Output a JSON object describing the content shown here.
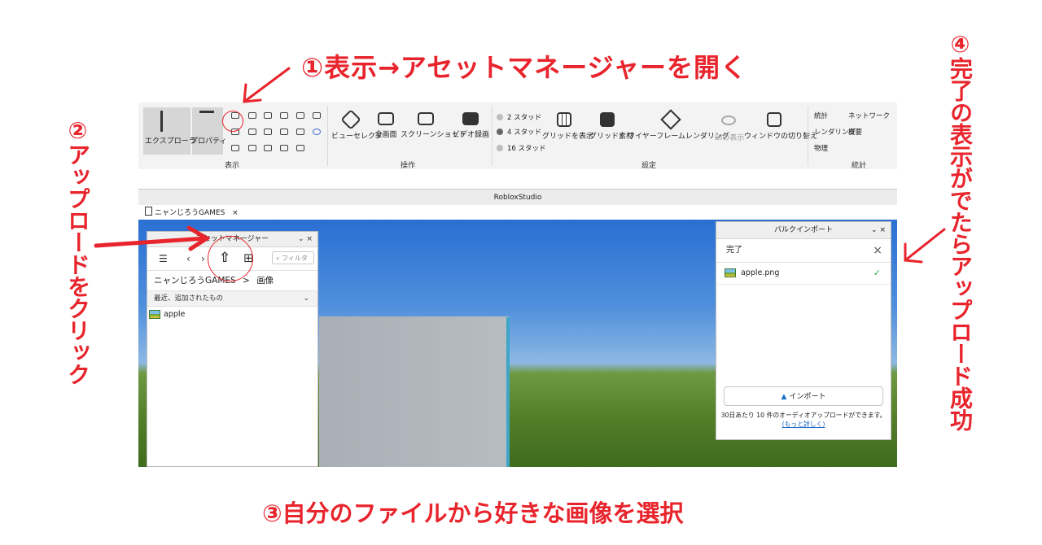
{
  "annotations": {
    "step1": "①表示→アセットマネージャーを開く",
    "step2": "②アップロードをクリック",
    "step3": "③自分のファイルから好きな画像を選択",
    "step4": "④完了の表示がでたらアップロード成功"
  },
  "ribbon": {
    "explorer_label": "エクスプローラ",
    "properties_label": "プロパティ",
    "view_group": "表示",
    "view_selector": "ビューセレクタ",
    "fullscreen": "全画面",
    "screenshot": "スクリーンショット",
    "video_record": "ビデオ録画",
    "actions_group": "操作",
    "stud2": "2 スタッド",
    "stud4": "4 スタッド",
    "stud16": "16 スタッド",
    "show_grid": "グリッドを表示",
    "grid_material": "グリッド素材",
    "wireframe": "ワイヤーフレームレンダリング",
    "ui_display": "UIの表示",
    "window_toggle": "ウィンドウの切り替え",
    "settings_group": "設定",
    "stats": "統計",
    "network": "ネットワーク",
    "rendering": "レンダリング",
    "summary": "概要",
    "physics": "物理",
    "stats_group": "統計"
  },
  "studio": {
    "title": "RobloxStudio",
    "tab_label": "ニャンじろうGAMES",
    "tab_close": "×"
  },
  "asset_manager": {
    "title": "アセットマネージャー",
    "window_ctl": "⌄ ×",
    "search_placeholder": "フィルタ",
    "crumb_root": "ニャンじろうGAMES",
    "crumb_sep": ">",
    "crumb_folder": "画像",
    "section": "最近、追加されたもの",
    "items": [
      {
        "name": "apple"
      }
    ]
  },
  "bulk_import": {
    "title": "バルクインポート",
    "window_ctl": "⌄ ×",
    "status": "完了",
    "close": "×",
    "files": [
      {
        "name": "apple.png"
      }
    ],
    "import_button": "インポート",
    "note": "30日あたり 10 件のオーディオアップロードができます。",
    "note_link": "(もっと詳しく)"
  },
  "colors": {
    "annotation_red": "#e8242c",
    "success_green": "#2ea84a",
    "link_blue": "#1a63c2"
  }
}
